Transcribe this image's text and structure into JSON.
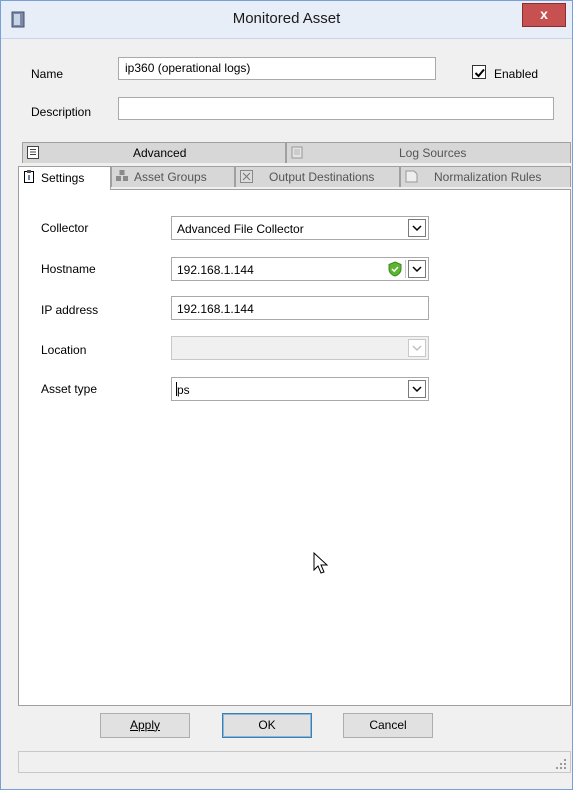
{
  "window": {
    "title": "Monitored Asset",
    "close_label": "x"
  },
  "form": {
    "name_label": "Name",
    "name_value": "ip360 (operational logs)",
    "enabled_label": "Enabled",
    "enabled_checked": true,
    "description_label": "Description",
    "description_value": ""
  },
  "tabs": {
    "row1": [
      {
        "label": "Advanced",
        "icon": "advanced-icon"
      },
      {
        "label": "Log Sources",
        "icon": "log-sources-icon"
      }
    ],
    "row2": [
      {
        "label": "Settings",
        "icon": "settings-icon",
        "active": true
      },
      {
        "label": "Asset Groups",
        "icon": "asset-groups-icon"
      },
      {
        "label": "Output Destinations",
        "icon": "output-destinations-icon"
      },
      {
        "label": "Normalization Rules",
        "icon": "normalization-rules-icon"
      }
    ]
  },
  "settings": {
    "collector_label": "Collector",
    "collector_value": "Advanced File Collector",
    "hostname_label": "Hostname",
    "hostname_value": "192.168.1.144",
    "ip_label": "IP address",
    "ip_value": "192.168.1.144",
    "location_label": "Location",
    "location_value": "",
    "asset_type_label": "Asset type",
    "asset_type_value": "ps"
  },
  "buttons": {
    "apply": "Apply",
    "ok": "OK",
    "cancel": "Cancel"
  },
  "colors": {
    "hostname_status": "#5cb531"
  }
}
